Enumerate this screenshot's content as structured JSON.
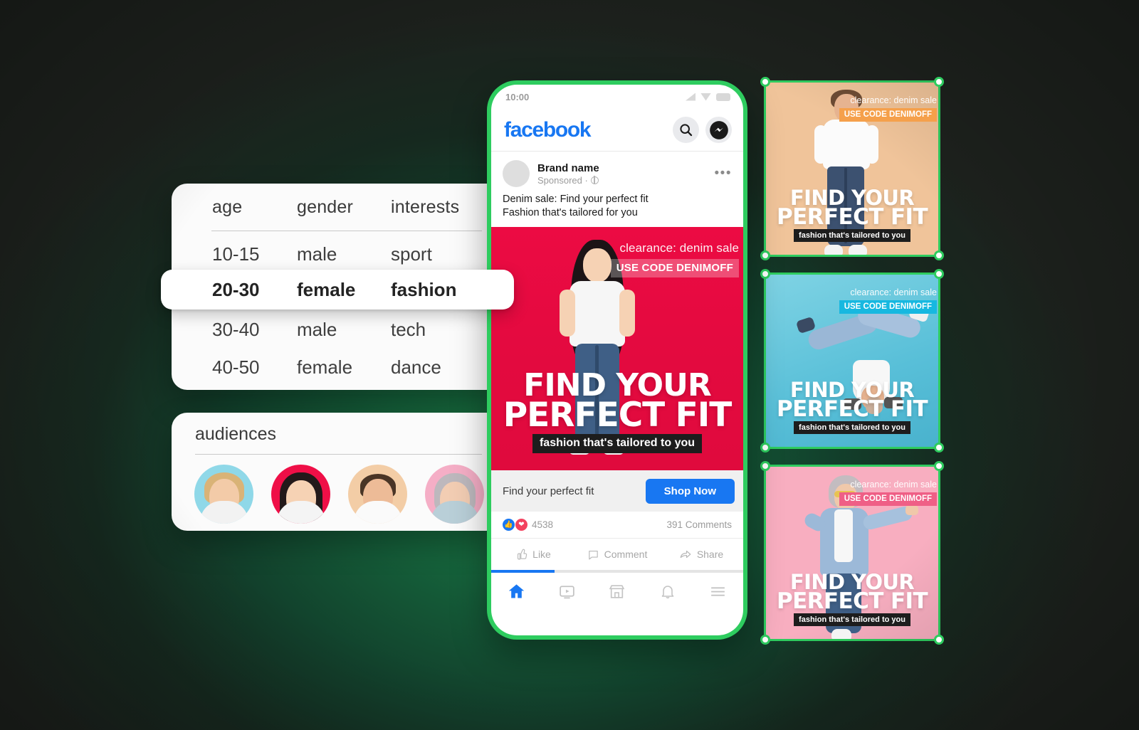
{
  "theme": {
    "green_accent": "#2ecc5f",
    "facebook_blue": "#1877F2",
    "creative_red": "#ec0b43"
  },
  "targeting_card": {
    "columns": [
      "age",
      "gender",
      "interests"
    ],
    "rows": [
      {
        "age": "10-15",
        "gender": "male",
        "interests": "sport"
      },
      {
        "age": "30-40",
        "gender": "male",
        "interests": "tech"
      },
      {
        "age": "40-50",
        "gender": "female",
        "interests": "dance"
      }
    ],
    "selected_row": {
      "age": "20-30",
      "gender": "female",
      "interests": "fashion"
    }
  },
  "audiences_card": {
    "title": "audiences",
    "avatars": [
      {
        "name": "audience-avatar-child",
        "bg": "#8fd8e8"
      },
      {
        "name": "audience-avatar-young-woman",
        "bg": "#ef0f47"
      },
      {
        "name": "audience-avatar-man",
        "bg": "#f3cda6"
      },
      {
        "name": "audience-avatar-senior-woman",
        "bg": "#f5aec6"
      }
    ]
  },
  "phone": {
    "status_bar": {
      "time": "10:00",
      "icons": [
        "signal-icon",
        "wifi-icon",
        "battery-icon"
      ]
    },
    "app_bar": {
      "wordmark": "facebook",
      "search_icon": "search-icon",
      "messenger_icon": "messenger-icon"
    },
    "post": {
      "brand_name": "Brand name",
      "sponsored_label": "Sponsored ·",
      "globe_icon": "globe-icon",
      "more_icon": "more-options-icon",
      "body_line1": "Denim sale: Find your perfect fit",
      "body_line2": "Fashion that's tailored for you"
    },
    "creative": {
      "clearance": "clearance: denim sale",
      "promo_code": "USE CODE DENIMOFF",
      "headline_line1": "FIND YOUR",
      "headline_line2": "PERFECT FIT",
      "subline": "fashion that's tailored to you"
    },
    "cta": {
      "text": "Find your perfect fit",
      "button_label": "Shop Now"
    },
    "engagement": {
      "like_icon": "thumbs-up-reaction-icon",
      "love_icon": "heart-reaction-icon",
      "reactions": "4538",
      "comments": "391 Comments"
    },
    "actions": [
      {
        "label": "Like",
        "icon": "thumbs-up-icon"
      },
      {
        "label": "Comment",
        "icon": "comment-bubble-icon"
      },
      {
        "label": "Share",
        "icon": "share-arrow-icon"
      }
    ],
    "tabbar": [
      {
        "name": "tab-home",
        "icon": "home-icon",
        "active": true
      },
      {
        "name": "tab-watch",
        "icon": "video-play-icon",
        "active": false
      },
      {
        "name": "tab-marketplace",
        "icon": "storefront-icon",
        "active": false
      },
      {
        "name": "tab-notifications",
        "icon": "bell-icon",
        "active": false
      },
      {
        "name": "tab-menu",
        "icon": "hamburger-menu-icon",
        "active": false
      }
    ]
  },
  "ad_variants": [
    {
      "id": "ad-card-1",
      "clearance": "clearance: denim sale",
      "promo_code": "USE CODE DENIMOFF",
      "headline_line1": "FIND YOUR",
      "headline_line2": "PERFECT FIT",
      "subline": "fashion that's tailored to you",
      "bg": "#f0c49a",
      "badge_bg": "#f5a04b"
    },
    {
      "id": "ad-card-2",
      "clearance": "clearance: denim sale",
      "promo_code": "USE CODE DENIMOFF",
      "headline_line1": "FIND YOUR",
      "headline_line2": "PERFECT FIT",
      "subline": "fashion that's tailored to you",
      "bg": "#67c9de",
      "badge_bg": "#17b8e0"
    },
    {
      "id": "ad-card-3",
      "clearance": "clearance: denim sale",
      "promo_code": "USE CODE DENIMOFF",
      "headline_line1": "FIND YOUR",
      "headline_line2": "PERFECT FIT",
      "subline": "fashion that's tailored to you",
      "bg": "#f8aec0",
      "badge_bg": "#ef5f86"
    }
  ]
}
